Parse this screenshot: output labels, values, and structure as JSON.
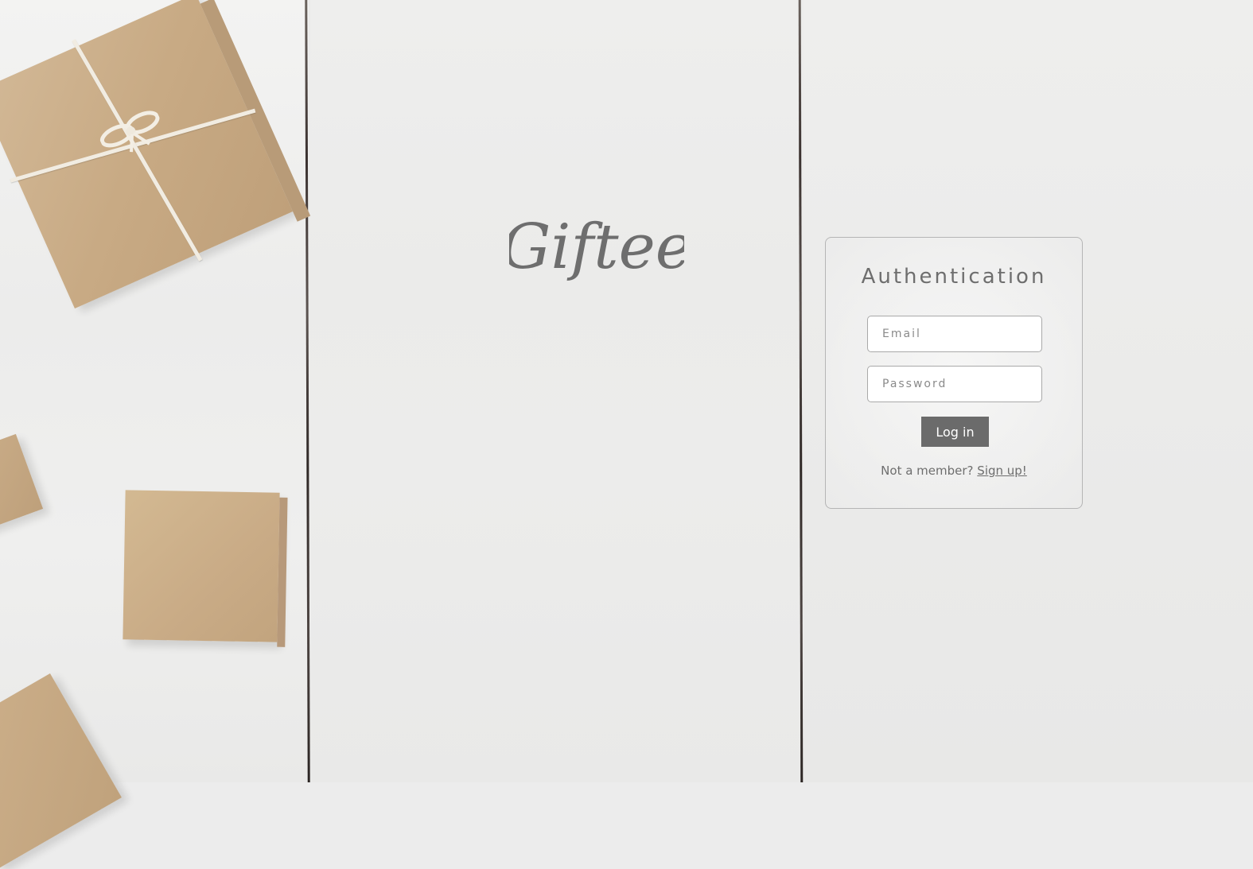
{
  "brand": {
    "logo_text": "Giftee"
  },
  "auth": {
    "title": "Authentication",
    "email_placeholder": "Email",
    "password_placeholder": "Password",
    "login_label": "Log in",
    "not_member_text": "Not a member?",
    "signup_label": "Sign up!"
  },
  "colors": {
    "text_gray": "#6e6e6e",
    "button_bg": "#6b6b6b",
    "button_text": "#ffffff",
    "card_border": "#b5b5b5"
  }
}
